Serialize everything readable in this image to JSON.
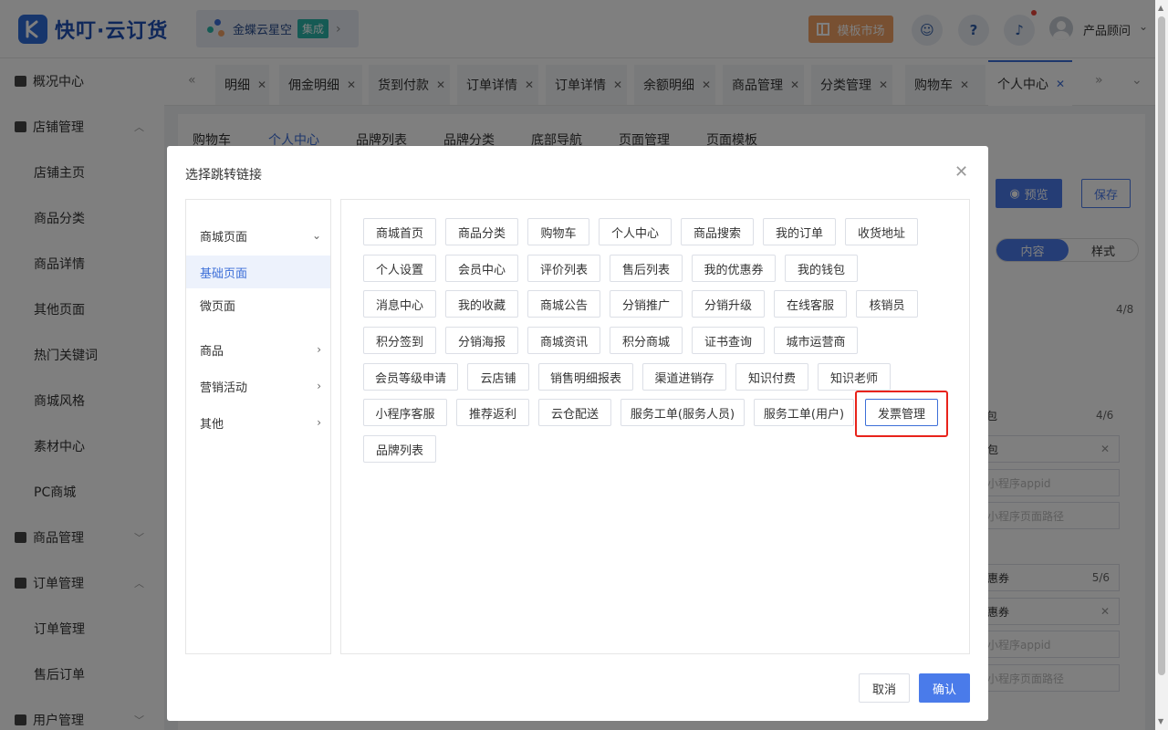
{
  "app": {
    "name": "快叮·云订货"
  },
  "org": {
    "name": "金蝶云星空",
    "badge": "集成"
  },
  "header": {
    "market_label": "模板市场",
    "user_name": "产品顾问"
  },
  "sidebar": {
    "items": [
      {
        "label": "概况中心",
        "type": "group"
      },
      {
        "label": "店铺管理",
        "type": "group",
        "expanded": true
      },
      {
        "label": "店铺主页",
        "type": "sub"
      },
      {
        "label": "商品分类",
        "type": "sub"
      },
      {
        "label": "商品详情",
        "type": "sub"
      },
      {
        "label": "其他页面",
        "type": "sub"
      },
      {
        "label": "热门关键词",
        "type": "sub"
      },
      {
        "label": "商城风格",
        "type": "sub"
      },
      {
        "label": "素材中心",
        "type": "sub"
      },
      {
        "label": "PC商城",
        "type": "sub"
      },
      {
        "label": "商品管理",
        "type": "group"
      },
      {
        "label": "订单管理",
        "type": "group",
        "expanded": true
      },
      {
        "label": "订单管理",
        "type": "sub"
      },
      {
        "label": "售后订单",
        "type": "sub"
      },
      {
        "label": "用户管理",
        "type": "group"
      }
    ]
  },
  "tabs": [
    {
      "label": "明细"
    },
    {
      "label": "佣金明细"
    },
    {
      "label": "货到付款"
    },
    {
      "label": "订单详情"
    },
    {
      "label": "订单详情"
    },
    {
      "label": "余额明细"
    },
    {
      "label": "商品管理"
    },
    {
      "label": "分类管理"
    },
    {
      "label": "购物车"
    },
    {
      "label": "个人中心",
      "active": true
    }
  ],
  "subtabs": [
    {
      "label": "购物车"
    },
    {
      "label": "个人中心",
      "active": true
    },
    {
      "label": "品牌列表"
    },
    {
      "label": "品牌分类"
    },
    {
      "label": "底部导航"
    },
    {
      "label": "页面管理"
    },
    {
      "label": "页面模板"
    }
  ],
  "background": {
    "preview_label": "预览",
    "save_label": "保存",
    "seg_content": "内容",
    "seg_style": "样式",
    "count_1": "4/8",
    "count_2": "4/6",
    "count_3": "5/6",
    "field_1": "包",
    "field_2": "包",
    "field_3": "小程序appid",
    "field_4": "小程序页面路径",
    "field_5": "惠券",
    "field_6": "惠券",
    "field_7": "小程序appid",
    "field_8": "小程序页面路径"
  },
  "modal": {
    "title": "选择跳转链接",
    "left_items": [
      {
        "label": "商城页面",
        "chevron": "down"
      },
      {
        "label": "基础页面",
        "active": true
      },
      {
        "label": "微页面"
      },
      {
        "label": "商品",
        "chevron": "right"
      },
      {
        "label": "营销活动",
        "chevron": "right"
      },
      {
        "label": "其他",
        "chevron": "right"
      }
    ],
    "links": [
      [
        "商城首页",
        "商品分类",
        "购物车",
        "个人中心",
        "商品搜索",
        "我的订单",
        "收货地址"
      ],
      [
        "个人设置",
        "会员中心",
        "评价列表",
        "售后列表",
        "我的优惠券",
        "我的钱包"
      ],
      [
        "消息中心",
        "我的收藏",
        "商城公告",
        "分销推广",
        "分销升级",
        "在线客服",
        "核销员"
      ],
      [
        "积分签到",
        "分销海报",
        "商城资讯",
        "积分商城",
        "证书查询",
        "城市运营商"
      ],
      [
        "会员等级申请",
        "云店铺",
        "销售明细报表",
        "渠道进销存",
        "知识付费",
        "知识老师"
      ],
      [
        "小程序客服",
        "推荐返利",
        "云仓配送",
        "服务工单(服务人员)",
        "服务工单(用户)",
        "发票管理"
      ],
      [
        "品牌列表"
      ]
    ],
    "selected_link": "发票管理",
    "cancel_label": "取消",
    "confirm_label": "确认"
  },
  "colors": {
    "primary": "#4a7bea",
    "highlight": "#e8231b",
    "brand": "#1e4fb4"
  }
}
